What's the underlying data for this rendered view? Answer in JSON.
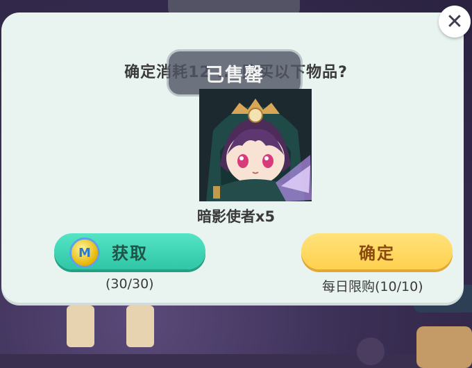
{
  "background": {
    "top_pill_label": "已售罄"
  },
  "dialog": {
    "close_label": "✕",
    "prompt": "确定消耗12 ... 购买以下物品?",
    "sold_out_label": "已售罄",
    "item_name": "暗影使者x5",
    "get_button_label": "获取",
    "get_coin_letter": "M",
    "get_count": "(30/30)",
    "confirm_button_label": "确定",
    "daily_limit": "每日限购(10/10)"
  },
  "colors": {
    "dialog_bg": "#e9f4f1",
    "get_button": "#3fd6b6",
    "confirm_button": "#ffd860"
  }
}
